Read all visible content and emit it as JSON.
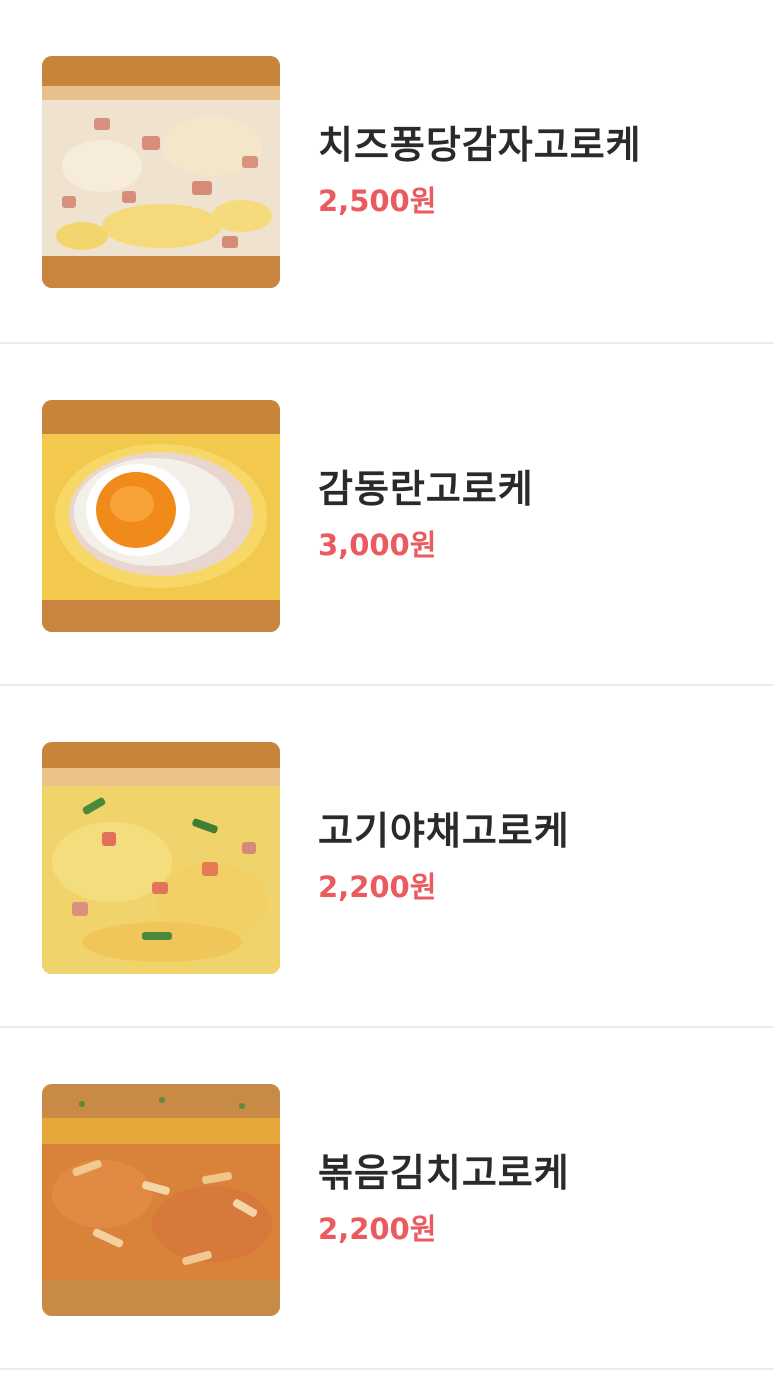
{
  "items": [
    {
      "name": "치즈퐁당감자고로케",
      "price": "2,500원",
      "image": "cheese-potato-croquette-image"
    },
    {
      "name": "감동란고로케",
      "price": "3,000원",
      "image": "egg-croquette-image"
    },
    {
      "name": "고기야채고로케",
      "price": "2,200원",
      "image": "meat-vegetable-croquette-image"
    },
    {
      "name": "볶음김치고로케",
      "price": "2,200원",
      "image": "kimchi-croquette-image"
    }
  ],
  "colors": {
    "price": "#ea5a5f",
    "name": "#2a2a2a",
    "divider": "#ececec"
  }
}
